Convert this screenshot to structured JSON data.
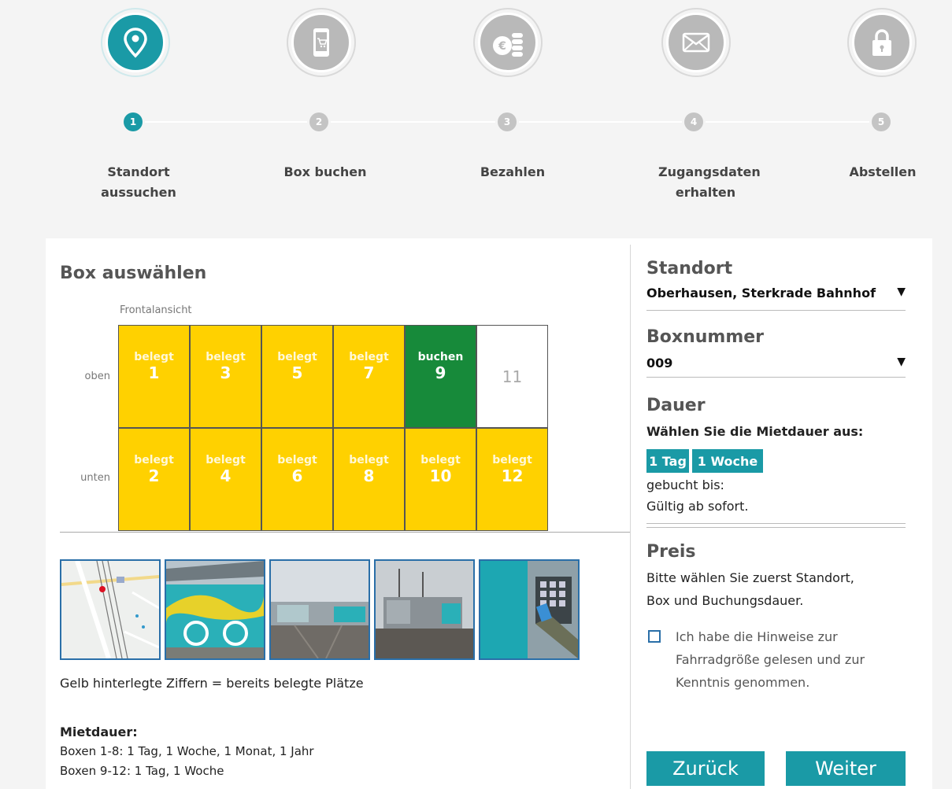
{
  "colors": {
    "accent": "#1a9aa6",
    "occupied": "#ffd100",
    "free": "#178a3a"
  },
  "steps": [
    {
      "num": "1",
      "label": "Standort aussuchen",
      "icon": "location-pin-icon",
      "active": true
    },
    {
      "num": "2",
      "label": "Box buchen",
      "icon": "smartphone-cart-icon",
      "active": false
    },
    {
      "num": "3",
      "label": "Bezahlen",
      "icon": "euro-coins-icon",
      "active": false
    },
    {
      "num": "4",
      "label": "Zugangsdaten erhalten",
      "icon": "envelope-icon",
      "active": false
    },
    {
      "num": "5",
      "label": "Abstellen",
      "icon": "padlock-icon",
      "active": false
    }
  ],
  "box_select": {
    "title": "Box auswählen",
    "front_label": "Frontalansicht",
    "row_top": "oben",
    "row_bottom": "unten",
    "boxes_top": [
      {
        "status": "belegt",
        "number": "1"
      },
      {
        "status": "belegt",
        "number": "3"
      },
      {
        "status": "belegt",
        "number": "5"
      },
      {
        "status": "belegt",
        "number": "7"
      },
      {
        "status": "buchen",
        "number": "9"
      },
      {
        "status": "",
        "number": "11"
      }
    ],
    "boxes_bottom": [
      {
        "status": "belegt",
        "number": "2"
      },
      {
        "status": "belegt",
        "number": "4"
      },
      {
        "status": "belegt",
        "number": "6"
      },
      {
        "status": "belegt",
        "number": "8"
      },
      {
        "status": "belegt",
        "number": "10"
      },
      {
        "status": "belegt",
        "number": "12"
      }
    ],
    "legend": "Gelb hinterlegte Ziffern = bereits belegte Plätze",
    "mietdauer_title": "Mietdauer:",
    "mietdauer_lines": [
      "Boxen 1-8: 1 Tag, 1 Woche, 1 Monat, 1 Jahr",
      "Boxen 9-12: 1 Tag, 1 Woche"
    ]
  },
  "sidebar": {
    "standort_label": "Standort",
    "standort_value": "Oberhausen, Sterkrade Bahnhof",
    "boxnummer_label": "Boxnummer",
    "boxnummer_value": "009",
    "dauer_label": "Dauer",
    "dauer_prompt": "Wählen Sie die Mietdauer aus:",
    "dauer_options": [
      "1 Tag",
      "1 Woche"
    ],
    "gebucht_bis": "gebucht bis:",
    "gueltig": "Gültig ab sofort.",
    "preis_label": "Preis",
    "preis_text_1": "Bitte wählen Sie zuerst Standort,",
    "preis_text_2": "Box und Buchungsdauer.",
    "checkbox_text": "Ich habe die Hinweise zur Fahrradgröße gelesen und zur Kenntnis genommen.",
    "back_button": "Zurück",
    "next_button": "Weiter"
  }
}
